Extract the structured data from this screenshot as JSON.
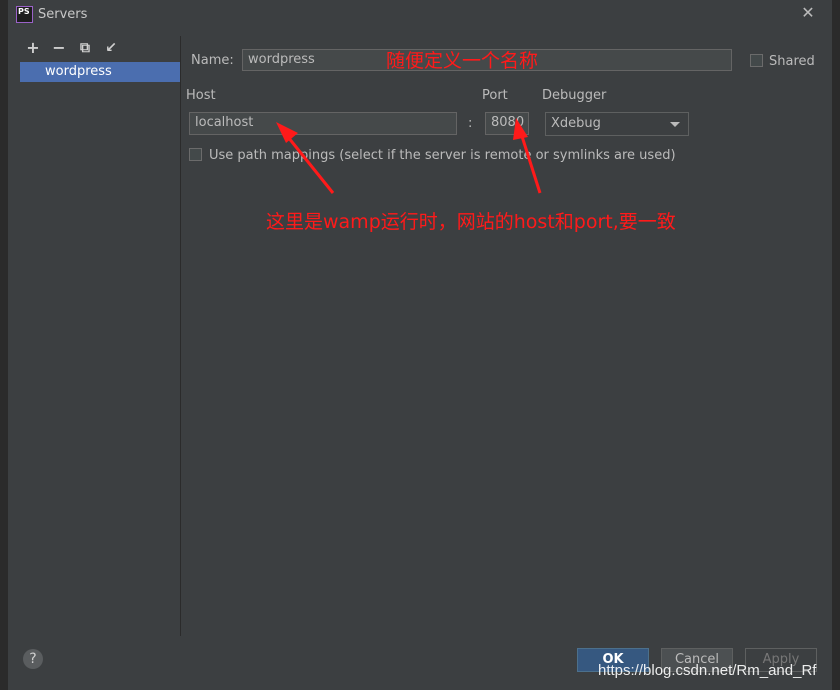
{
  "window": {
    "title": "Servers",
    "app_icon_text": "PS"
  },
  "toolbar": {
    "add": "+",
    "remove": "−",
    "copy": "⧉",
    "import": "↙"
  },
  "servers": [
    {
      "name": "wordpress"
    }
  ],
  "form": {
    "name_label": "Name:",
    "name_value": "wordpress",
    "shared_label": "Shared",
    "host_label": "Host",
    "host_value": "localhost",
    "colon": ":",
    "port_label": "Port",
    "port_value": "8080",
    "debugger_label": "Debugger",
    "debugger_value": "Xdebug",
    "path_mappings_label": "Use path mappings (select if the server is remote or symlinks are used)"
  },
  "annotations": {
    "name_note": "随便定义一个名称",
    "host_port_note": "这里是wamp运行时，网站的host和port,要一致",
    "color": "#ff1a1a"
  },
  "buttons": {
    "help": "?",
    "ok": "OK",
    "cancel": "Cancel",
    "apply": "Apply"
  },
  "watermark": "https://blog.csdn.net/Rm_and_Rf"
}
